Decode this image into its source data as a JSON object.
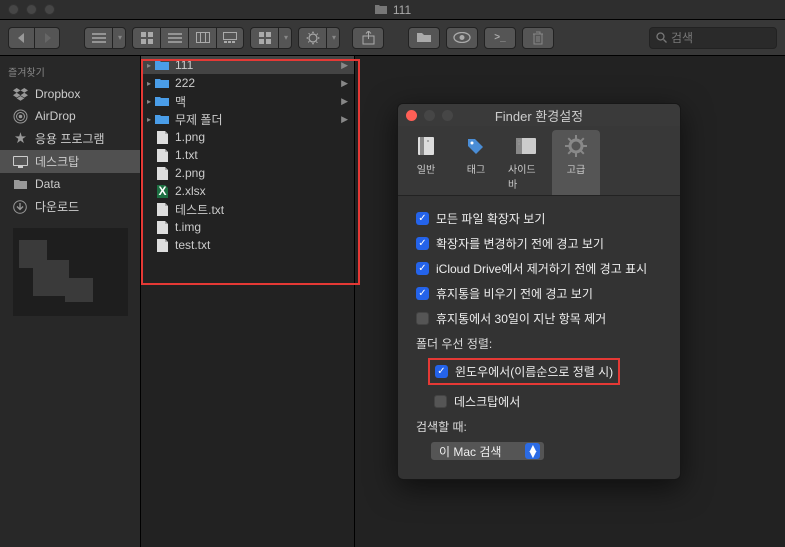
{
  "window": {
    "title": "111"
  },
  "toolbar": {
    "search_placeholder": "검색"
  },
  "sidebar": {
    "section": "즐겨찾기",
    "items": [
      {
        "label": "Dropbox",
        "icon": "dropbox"
      },
      {
        "label": "AirDrop",
        "icon": "airdrop"
      },
      {
        "label": "응용 프로그램",
        "icon": "apps"
      },
      {
        "label": "데스크탑",
        "icon": "desktop",
        "selected": true
      },
      {
        "label": "Data",
        "icon": "folder"
      },
      {
        "label": "다운로드",
        "icon": "downloads"
      }
    ]
  },
  "files": [
    {
      "name": "111",
      "type": "folder",
      "selected": true,
      "hasChildren": true
    },
    {
      "name": "222",
      "type": "folder",
      "hasChildren": true
    },
    {
      "name": "맥",
      "type": "folder",
      "hasChildren": true
    },
    {
      "name": "무제 폴더",
      "type": "folder",
      "hasChildren": true
    },
    {
      "name": "1.png",
      "type": "file"
    },
    {
      "name": "1.txt",
      "type": "file"
    },
    {
      "name": "2.png",
      "type": "file"
    },
    {
      "name": "2.xlsx",
      "type": "xlsx"
    },
    {
      "name": "테스트.txt",
      "type": "file"
    },
    {
      "name": "t.img",
      "type": "file"
    },
    {
      "name": "test.txt",
      "type": "file"
    }
  ],
  "prefs": {
    "title": "Finder 환경설정",
    "tabs": {
      "general": "일반",
      "tags": "태그",
      "sidebar": "사이드바",
      "advanced": "고급"
    },
    "checks": {
      "show_ext": "모든 파일 확장자 보기",
      "warn_change": "확장자를 변경하기 전에 경고 보기",
      "warn_icloud": "iCloud Drive에서 제거하기 전에 경고 표시",
      "warn_trash": "휴지통을 비우기 전에 경고 보기",
      "auto_trash": "휴지통에서 30일이 지난 항목 제거"
    },
    "sort_label": "폴더 우선 정렬:",
    "sort_window": "윈도우에서(이름순으로 정렬 시)",
    "sort_desktop": "데스크탑에서",
    "search_label": "검색할 때:",
    "search_value": "이 Mac 검색"
  }
}
